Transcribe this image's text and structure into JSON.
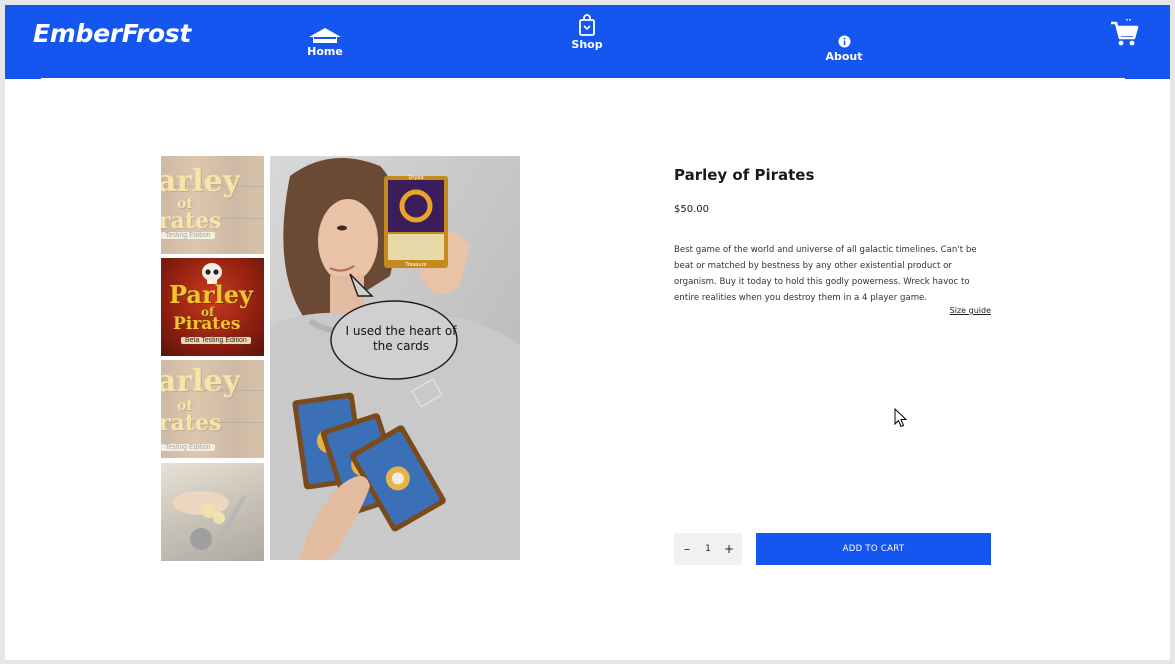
{
  "header": {
    "brand": "EmberFrost",
    "nav": [
      {
        "label": "Home",
        "icon": "home-icon"
      },
      {
        "label": "Shop",
        "icon": "shopping-bag-icon"
      },
      {
        "label": "About",
        "icon": "info-icon"
      }
    ],
    "cart_icon": "cart-icon"
  },
  "gallery": {
    "thumbnails": [
      {
        "title_line1": "arley",
        "title_line2": "of",
        "title_line3": "rates",
        "subtitle": "Testing Edition",
        "state": "faded"
      },
      {
        "title_line1": "Parley",
        "title_line2": "of",
        "title_line3": "Pirates",
        "subtitle": "Beta Testing Edition",
        "state": "selected"
      },
      {
        "title_line1": "arley",
        "title_line2": "of",
        "title_line3": "rates",
        "subtitle": "Testing Edition",
        "state": "faded"
      },
      {
        "title_line1": "",
        "title_line2": "",
        "title_line3": "",
        "subtitle": "",
        "state": "faded"
      }
    ],
    "main_image": {
      "speech_bubble": "I used the heart of the cards",
      "card_top_label": "Dryad",
      "card_bottom_label": "Treasure"
    }
  },
  "product": {
    "title": "Parley of Pirates",
    "price": "$50.00",
    "description": "Best game of the world and universe of all galactic timelines. Can't be beat or matched by bestness by any other existential product or organism. Buy it today to hold this godly powerness. Wreck havoc to entire realities when you destroy them in a 4 player game.",
    "size_guide": "Size guide",
    "quantity": {
      "minus": "–",
      "value": "1",
      "plus": "+"
    },
    "add_to_cart": "ADD TO CART"
  },
  "colors": {
    "brand_blue": "#1556f0",
    "white": "#ffffff"
  }
}
